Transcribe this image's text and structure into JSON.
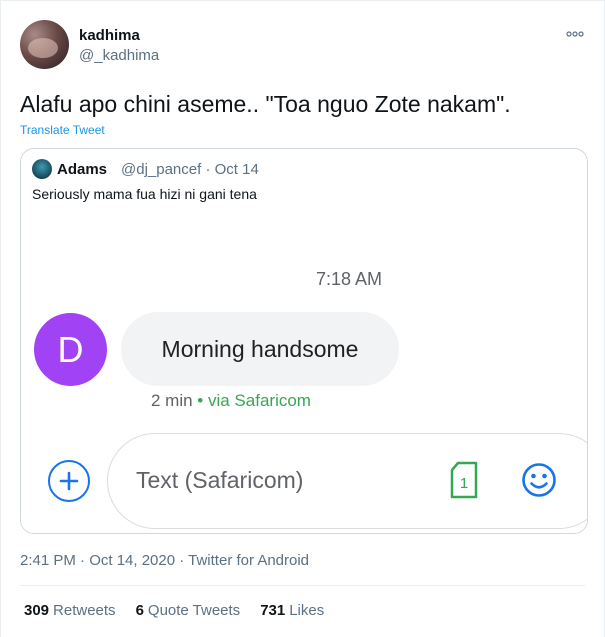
{
  "author": {
    "name": "kadhima",
    "handle": "@_kadhima"
  },
  "tweet": {
    "text": "Alafu apo chini aseme.. \"Toa nguo Zote nakam\".",
    "translate_label": "Translate Tweet"
  },
  "quoted": {
    "name": "Adams",
    "meta": "@dj_pancef · Oct 14",
    "text": "Seriously mama fua hizi ni gani tena",
    "screenshot": {
      "time": "7:18 AM",
      "avatar_letter": "D",
      "message": "Morning handsome",
      "status_age": "2 min",
      "status_via": " • via Safaricom",
      "compose_placeholder": "Text (Safaricom)",
      "sim_slot": "1",
      "accent_color": "#1a73e8",
      "avatar_color": "#a142f4",
      "via_color": "#34a853"
    }
  },
  "footer": {
    "timestamp": "2:41 PM · Oct 14, 2020 · Twitter for Android",
    "stats": [
      {
        "count": "309",
        "label": "Retweets"
      },
      {
        "count": "6",
        "label": "Quote Tweets"
      },
      {
        "count": "731",
        "label": "Likes"
      }
    ]
  },
  "icons": {
    "more": "more-horizontal-icon",
    "add": "add-circle-icon",
    "sim": "sim-card-icon",
    "emoji": "emoji-icon"
  }
}
